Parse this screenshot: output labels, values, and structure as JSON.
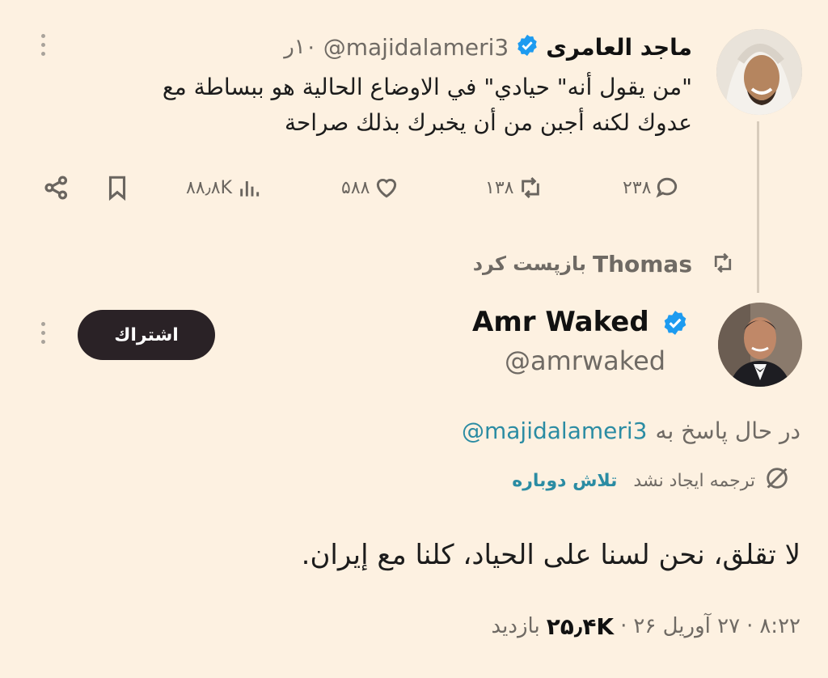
{
  "tweet1": {
    "author_name": "ماجد العامرى",
    "handle": "@majidalameri3",
    "time": "۱۰ر",
    "text_line1": "\"من يقول أنه\" حيادي\" في الاوضاع الحالية هو ببساطة مع",
    "text_line2": "عدوك لكنه أجبن من أن يخبرك بذلك صراحة",
    "replies": "۲۳۸",
    "retweets": "۱۳۸",
    "likes": "۵۸۸",
    "views": "۸۸٫۸K"
  },
  "retweet_banner": {
    "user": "Thomas",
    "label": "بازپست کرد"
  },
  "tweet2": {
    "author_name": "Amr Waked",
    "handle": "@amrwaked",
    "subscribe_label": "اشتراك",
    "replying_prefix": "در حال پاسخ به",
    "replying_handle": "@majidalameri3",
    "translation_failed": "ترجمه ایجاد نشد",
    "retry_label": "تلاش دوباره",
    "text": "لا تقلق، نحن لسنا على الحياد، كلنا مع إيران.",
    "meta_time": "۸:۲۲",
    "meta_date": "۲۷ آوریل ۲۶",
    "meta_views": "۲۵٫۴K",
    "meta_views_label": "بازدید"
  },
  "colors": {
    "background": "#fdf1e1",
    "verified": "#1d9bf0",
    "link": "#2b8ca3",
    "subscribe_bg": "#2a2226"
  }
}
